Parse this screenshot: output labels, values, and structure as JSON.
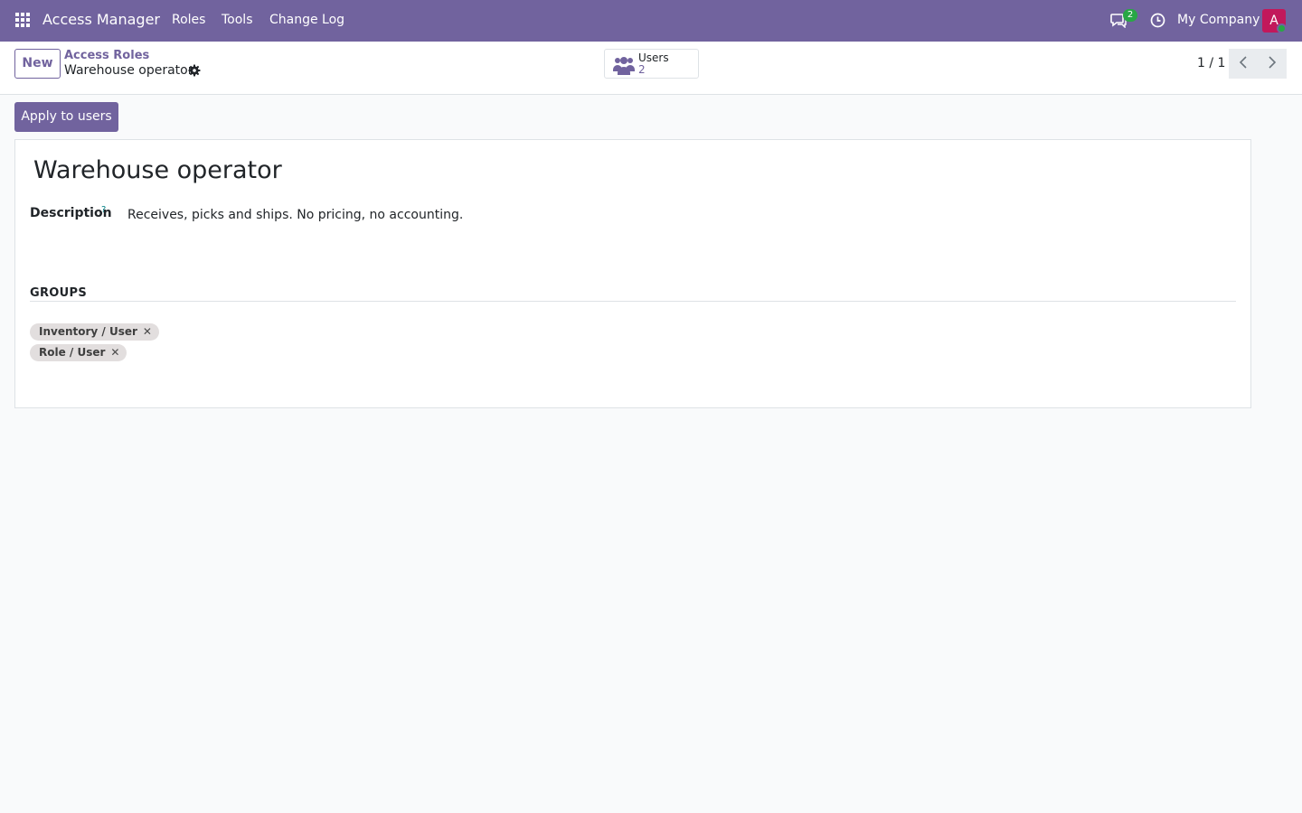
{
  "navbar": {
    "app_name": "Access Manager",
    "menu": [
      "Roles",
      "Tools",
      "Change Log"
    ],
    "messages_count": "2",
    "company": "My Company",
    "avatar_initial": "A",
    "colors": {
      "bar": "#71639e",
      "badge": "#28a745",
      "avatar": "#c2185b"
    },
    "icons": [
      "apps-grid-icon",
      "chat-icon",
      "clock-icon"
    ]
  },
  "control_panel": {
    "new_label": "New",
    "breadcrumb_parent": "Access Roles",
    "breadcrumb_current": "Warehouse operator",
    "smart_button": {
      "label": "Users",
      "value": "2"
    },
    "pager": "1 / 1"
  },
  "actions": {
    "apply_label": "Apply to users"
  },
  "form": {
    "title": "Warehouse operator",
    "description_label": "Description",
    "help_mark": "?",
    "description_value": "Receives, picks and ships. No pricing, no accounting.",
    "groups_section": "GROUPS",
    "groups": [
      "Inventory / User",
      "Role / User"
    ]
  }
}
